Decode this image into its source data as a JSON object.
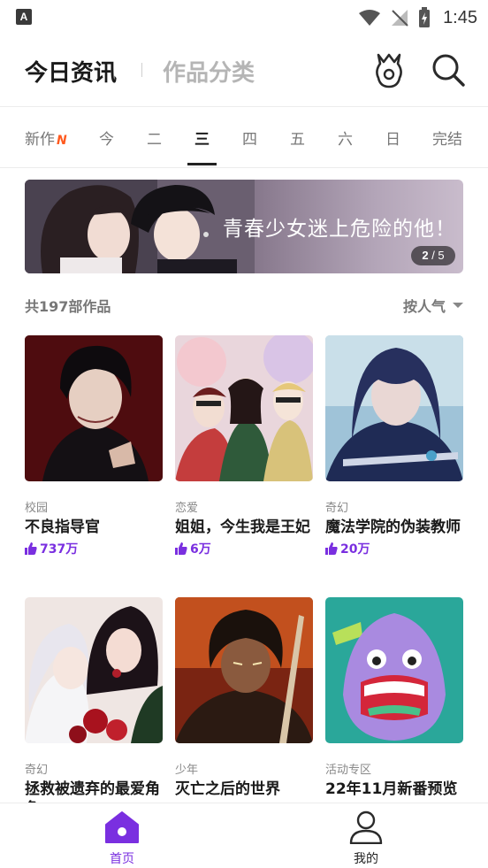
{
  "status_bar": {
    "app_badge": "A",
    "time": "1:45"
  },
  "header": {
    "tab_news": "今日资讯",
    "tab_categories": "作品分类"
  },
  "day_tabs": [
    {
      "label": "新作",
      "marker": "N"
    },
    {
      "label": "今"
    },
    {
      "label": "二"
    },
    {
      "label": "三",
      "active": true
    },
    {
      "label": "四"
    },
    {
      "label": "五"
    },
    {
      "label": "六"
    },
    {
      "label": "日"
    },
    {
      "label": "完结"
    }
  ],
  "banner": {
    "caption": "青春少女迷上危险的他！",
    "page_current": "2",
    "page_total": "5"
  },
  "list_header": {
    "count": "共197部作品",
    "sort": "按人气"
  },
  "works": [
    {
      "genre": "校园",
      "title": "不良指导官",
      "likes": "737万"
    },
    {
      "genre": "恋爱",
      "title": "姐姐，今生我是王妃",
      "likes": "6万"
    },
    {
      "genre": "奇幻",
      "title": "魔法学院的伪装教师",
      "likes": "20万"
    },
    {
      "genre": "奇幻",
      "title": "拯救被遗弃的最爱角色",
      "likes": ""
    },
    {
      "genre": "少年",
      "title": "灭亡之后的世界",
      "likes": ""
    },
    {
      "genre": "活动专区",
      "title": "22年11月新番预览",
      "likes": ""
    }
  ],
  "bottom_nav": {
    "home": "首页",
    "me": "我的"
  },
  "colors": {
    "accent": "#7a2fe0",
    "new_marker": "#ff5a1f"
  }
}
